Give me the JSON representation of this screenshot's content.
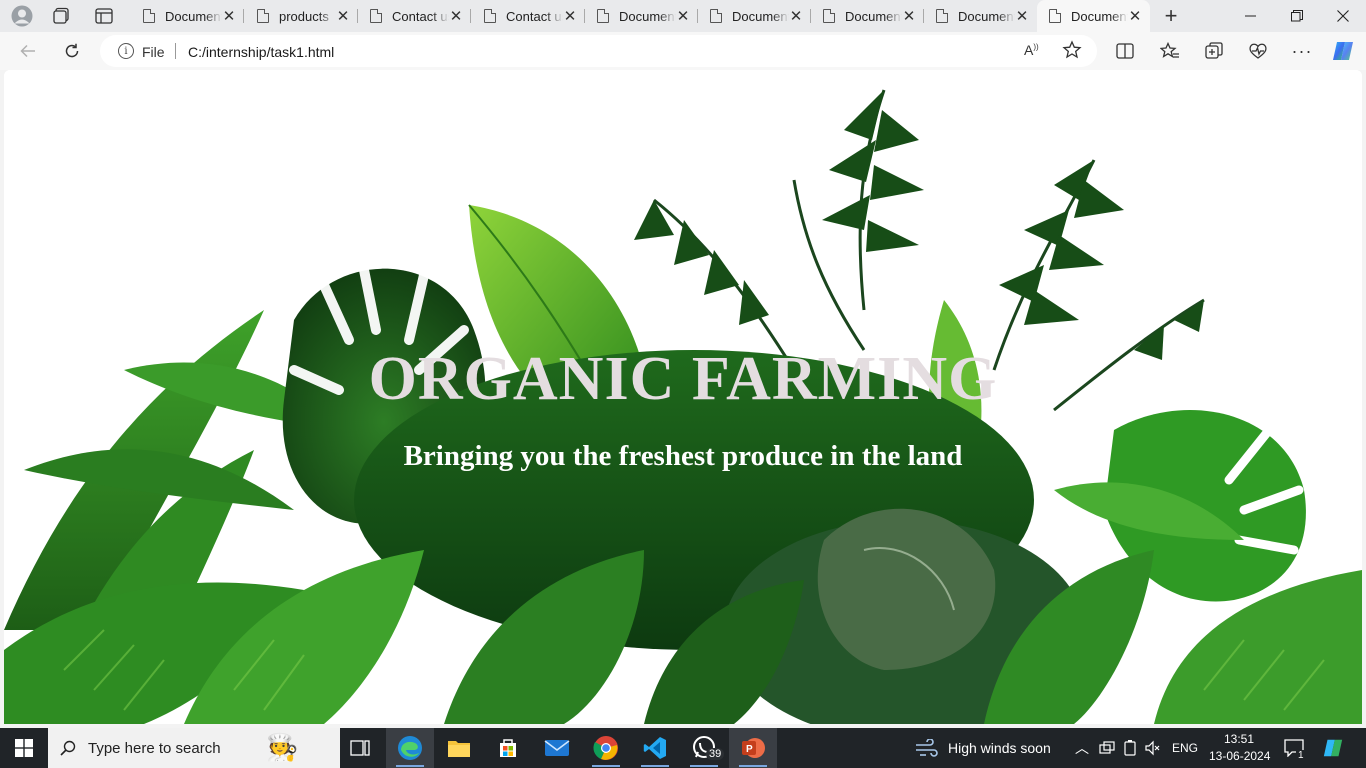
{
  "browser": {
    "tabs": [
      {
        "title": "Document",
        "active": false
      },
      {
        "title": "products",
        "active": false
      },
      {
        "title": "Contact us",
        "active": false
      },
      {
        "title": "Contact us",
        "active": false
      },
      {
        "title": "Document",
        "active": false
      },
      {
        "title": "Document",
        "active": false
      },
      {
        "title": "Document",
        "active": false
      },
      {
        "title": "Document",
        "active": false
      },
      {
        "title": "Document",
        "active": true
      }
    ],
    "new_tab_symbol": "+",
    "address": {
      "scheme_label": "File",
      "url": "C:/internship/task1.html"
    },
    "icons": {
      "profile": "profile-icon",
      "workspaces": "workspaces-icon",
      "tab_actions": "tab-actions-icon",
      "back": "back-icon",
      "refresh": "refresh-icon",
      "read_aloud": "read-aloud-icon",
      "favorite": "star-icon",
      "split_screen": "split-screen-icon",
      "favorites": "favorites-icon",
      "collections": "collections-icon",
      "performance": "performance-icon",
      "menu": "more-icon",
      "copilot": "copilot-icon"
    }
  },
  "page": {
    "hero_title": "ORGANIC FARMING",
    "hero_subtitle": "Bringing you the freshest produce in the land"
  },
  "taskbar": {
    "search_placeholder": "Type here to search",
    "whatsapp_badge": "39",
    "weather": "High winds soon",
    "language": "ENG",
    "time": "13:51",
    "date": "13-06-2024",
    "notifications_count": "1"
  }
}
